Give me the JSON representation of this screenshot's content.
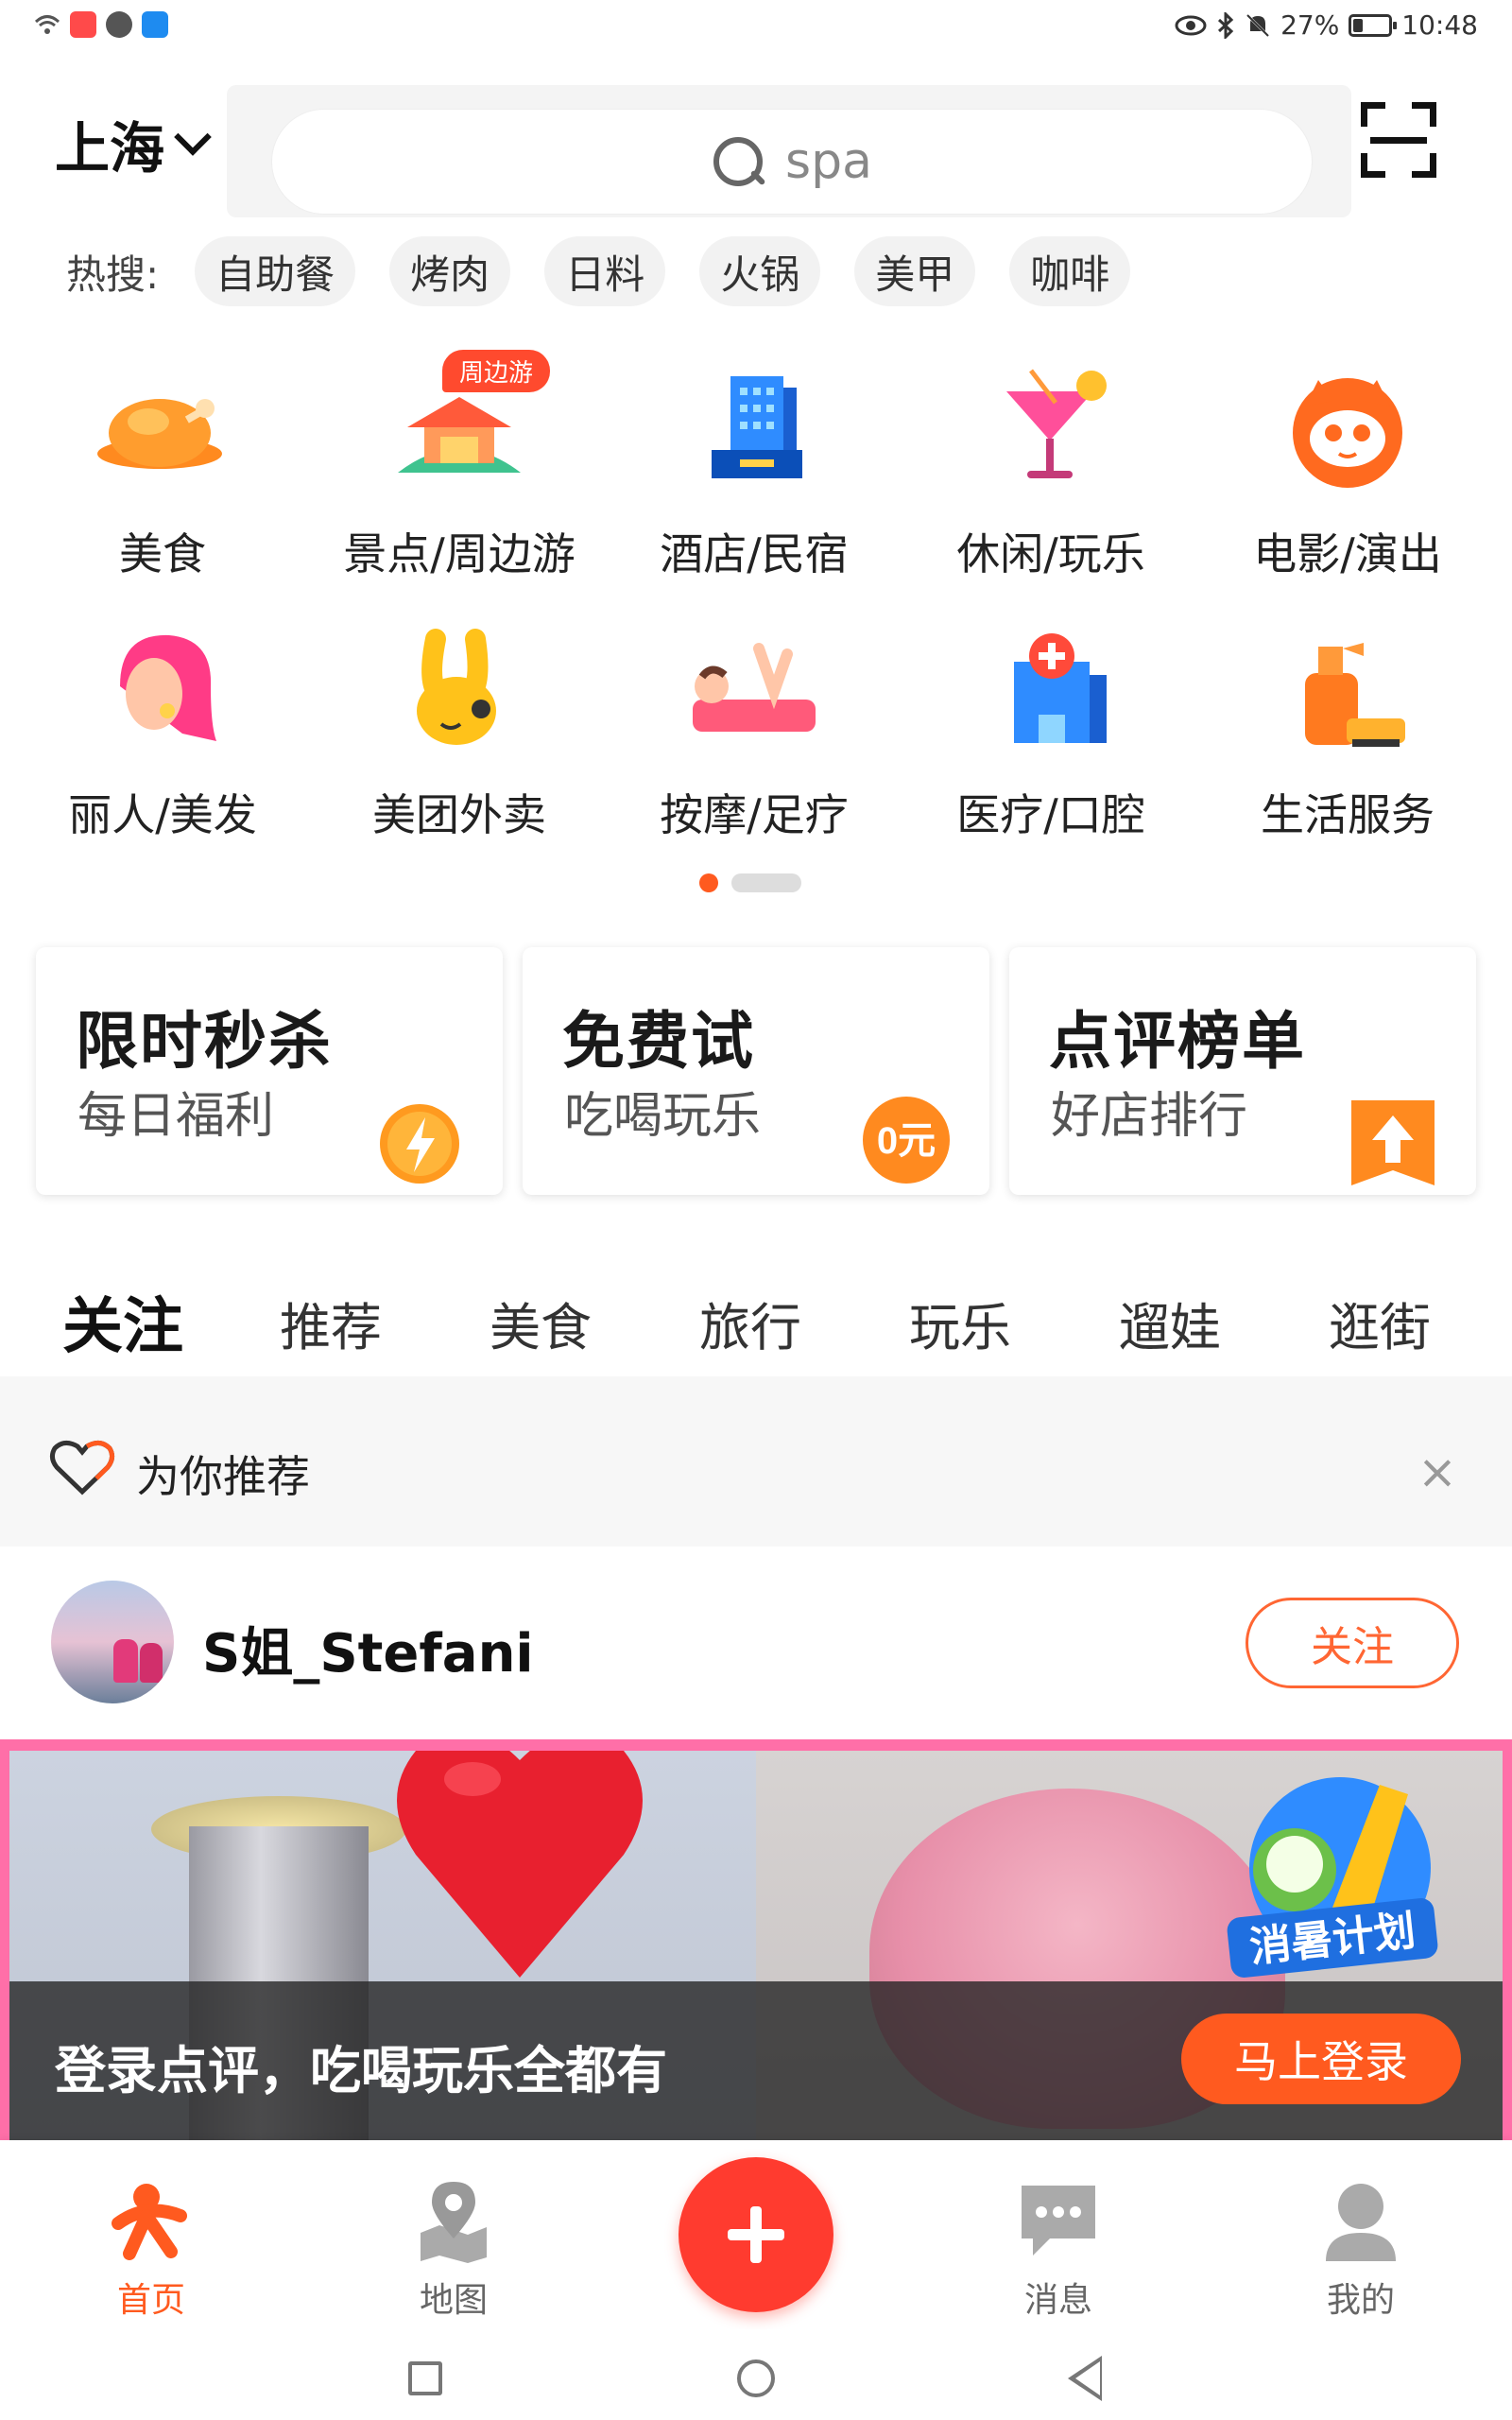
{
  "status_bar": {
    "battery_text": "27%",
    "battery_level": 0.27,
    "time": "10:48"
  },
  "header": {
    "city": "上海",
    "search_placeholder": "spa"
  },
  "hot_search": {
    "label": "热搜:",
    "chips": [
      "自助餐",
      "烤肉",
      "日料",
      "火锅",
      "美甲",
      "咖啡"
    ]
  },
  "categories": [
    {
      "label": "美食",
      "icon": "roast-chicken-icon"
    },
    {
      "label": "景点/周边游",
      "icon": "pavilion-icon",
      "tag": "周边游"
    },
    {
      "label": "酒店/民宿",
      "icon": "hotel-building-icon"
    },
    {
      "label": "休闲/玩乐",
      "icon": "cocktail-icon"
    },
    {
      "label": "电影/演出",
      "icon": "cat-mascot-icon"
    },
    {
      "label": "丽人/美发",
      "icon": "woman-hair-icon"
    },
    {
      "label": "美团外卖",
      "icon": "kangaroo-icon"
    },
    {
      "label": "按摩/足疗",
      "icon": "massage-icon"
    },
    {
      "label": "医疗/口腔",
      "icon": "hospital-icon"
    },
    {
      "label": "生活服务",
      "icon": "cleaning-spray-icon"
    }
  ],
  "pager": {
    "pages": 2,
    "current": 1
  },
  "promo_cards": [
    {
      "title": "限时秒杀",
      "subtitle": "每日福利",
      "badge_icon": "lightning-clock-icon"
    },
    {
      "title": "免费试",
      "subtitle": "吃喝玩乐",
      "badge_icon": "zero-yuan-icon",
      "badge_text": "0元"
    },
    {
      "title": "点评榜单",
      "subtitle": "好店排行",
      "badge_icon": "up-arrow-flag-icon"
    }
  ],
  "feed_tabs": [
    "关注",
    "推荐",
    "美食",
    "旅行",
    "玩乐",
    "遛娃",
    "逛街"
  ],
  "active_tab": "关注",
  "recommend": {
    "title": "为你推荐",
    "close": "×"
  },
  "user": {
    "name": "S姐_Stefani",
    "follow_label": "关注"
  },
  "banner": {
    "sticker_text": "消暑计划",
    "login_prompt": "登录点评，吃喝玩乐全都有",
    "login_button": "马上登录"
  },
  "bottom_nav": [
    {
      "label": "首页",
      "icon": "home-mascot-icon",
      "active": true
    },
    {
      "label": "地图",
      "icon": "map-pin-icon",
      "active": false
    },
    {
      "label": "",
      "icon": "plus-icon",
      "active": false
    },
    {
      "label": "消息",
      "icon": "chat-bubble-icon",
      "active": false
    },
    {
      "label": "我的",
      "icon": "user-profile-icon",
      "active": false
    }
  ],
  "colors": {
    "accent": "#ff5a1f",
    "primary_red": "#ff3b2f",
    "follow": "#ff6633"
  }
}
